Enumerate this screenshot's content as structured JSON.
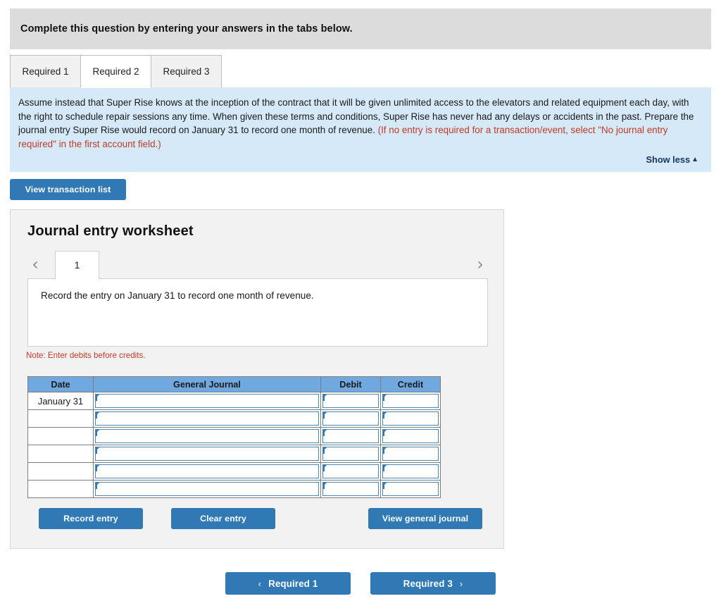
{
  "banner": {
    "text": "Complete this question by entering your answers in the tabs below."
  },
  "tabs": [
    {
      "label": "Required 1",
      "active": false
    },
    {
      "label": "Required 2",
      "active": true
    },
    {
      "label": "Required 3",
      "active": false
    }
  ],
  "question": {
    "body": "Assume instead that Super Rise knows at the inception of the contract that it will be given unlimited access to the elevators and related equipment each day, with the right to schedule repair sessions any time. When given these terms and conditions, Super Rise has never had any delays or accidents in the past. Prepare the journal entry Super Rise would record on January 31 to record one month of revenue. ",
    "hint": "(If no entry is required for a transaction/event, select \"No journal entry required\" in the first account field.)",
    "show_less_label": "Show less",
    "show_less_caret": "▲"
  },
  "toolbar": {
    "view_transaction_list_label": "View transaction list"
  },
  "worksheet": {
    "title": "Journal entry worksheet",
    "pager": {
      "prev_icon": "‹",
      "next_icon": "›",
      "current_page": "1"
    },
    "entry_description": "Record the entry on January 31 to record one month of revenue.",
    "note": "Note: Enter debits before credits.",
    "table": {
      "columns": [
        "Date",
        "General Journal",
        "Debit",
        "Credit"
      ],
      "rows": [
        {
          "date": "January 31",
          "general_journal": "",
          "debit": "",
          "credit": ""
        },
        {
          "date": "",
          "general_journal": "",
          "debit": "",
          "credit": ""
        },
        {
          "date": "",
          "general_journal": "",
          "debit": "",
          "credit": ""
        },
        {
          "date": "",
          "general_journal": "",
          "debit": "",
          "credit": ""
        },
        {
          "date": "",
          "general_journal": "",
          "debit": "",
          "credit": ""
        },
        {
          "date": "",
          "general_journal": "",
          "debit": "",
          "credit": ""
        }
      ]
    },
    "actions": {
      "record_entry_label": "Record entry",
      "clear_entry_label": "Clear entry",
      "view_general_journal_label": "View general journal"
    }
  },
  "bottom_nav": {
    "prev_chevron": "‹",
    "prev_label": "Required 1",
    "next_label": "Required 3",
    "next_chevron": "›"
  },
  "colors": {
    "accent_blue": "#3079b5",
    "table_header_blue": "#6fa9e0",
    "question_panel_blue": "#d6e9f8",
    "banner_gray": "#dcdcdc",
    "panel_gray": "#f2f2f2",
    "note_red": "#c0392b",
    "show_less_navy": "#14365c"
  }
}
